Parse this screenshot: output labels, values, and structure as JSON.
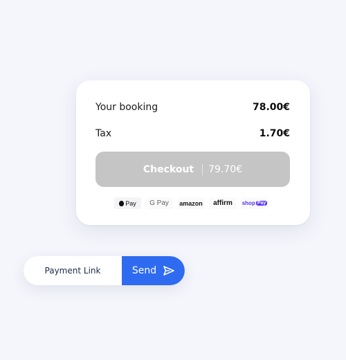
{
  "booking": {
    "label": "Your booking",
    "amount": "78.00€"
  },
  "tax": {
    "label": "Tax",
    "amount": "1.70€"
  },
  "checkout": {
    "label": "Checkout",
    "amount": "79.70€",
    "color": "#c5c5c5"
  },
  "payment_methods": [
    {
      "name": "Apple Pay",
      "text": "Pay",
      "icon": "apple-icon"
    },
    {
      "name": "Google Pay",
      "text": "G Pay"
    },
    {
      "name": "Amazon",
      "text": "amazon"
    },
    {
      "name": "Affirm",
      "text": "affirm"
    },
    {
      "name": "Shop Pay",
      "text": "shop",
      "badge": "Pay"
    }
  ],
  "payment_link": {
    "label": "Payment Link",
    "send_label": "Send",
    "send_color": "#2f6bf0",
    "send_icon": "send-icon"
  }
}
